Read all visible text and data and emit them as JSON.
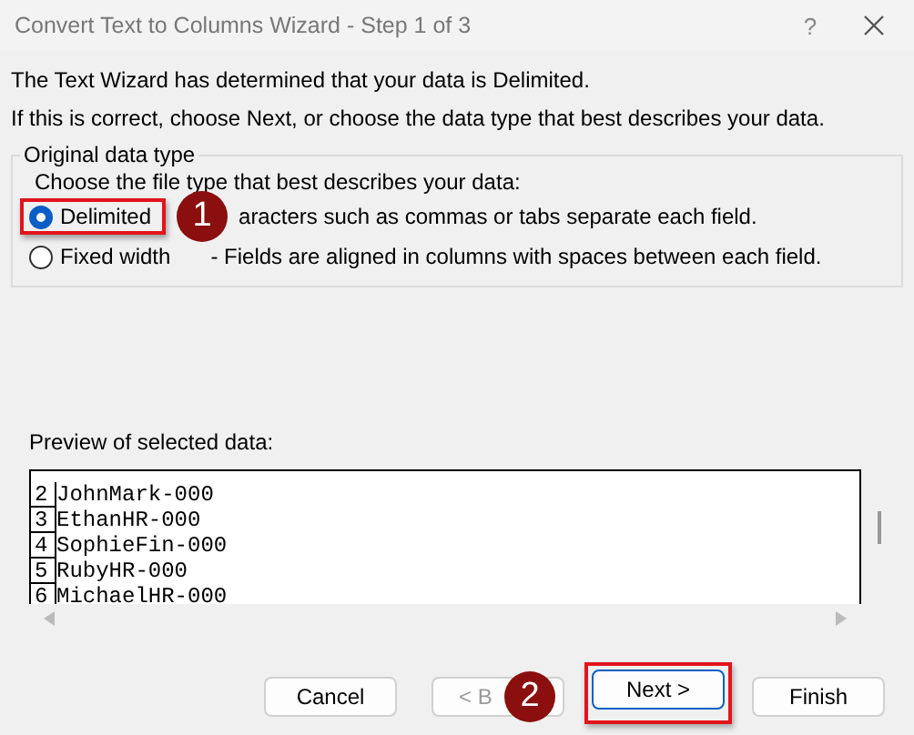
{
  "window": {
    "title": "Convert Text to Columns Wizard - Step 1 of 3",
    "help": "?"
  },
  "intro": [
    "The Text Wizard has determined that your data is Delimited.",
    "If this is correct, choose Next, or choose the data type that best describes your data."
  ],
  "group": {
    "title": "Original data type",
    "prompt": "Choose the file type that best describes your data:",
    "options": [
      {
        "label": "Delimited",
        "description": "aracters such as commas or tabs separate each field.",
        "selected": true,
        "highlighted": true,
        "badge": "1"
      },
      {
        "label": "Fixed width",
        "description": "- Fields are aligned in columns with spaces between each field.",
        "selected": false,
        "highlighted": false
      }
    ]
  },
  "preview": {
    "label": "Preview of selected data:",
    "rows": [
      {
        "number": "2",
        "text": "JohnMark-000"
      },
      {
        "number": "3",
        "text": "EthanHR-000"
      },
      {
        "number": "4",
        "text": "SophieFin-000"
      },
      {
        "number": "5",
        "text": "RubyHR-000"
      },
      {
        "number": "6",
        "text": "MichaelHR-000"
      }
    ]
  },
  "buttons": [
    {
      "label": "Cancel",
      "disabled": false,
      "default": false,
      "highlighted": false
    },
    {
      "label": "< B",
      "disabled": true,
      "default": false,
      "highlighted": false,
      "badge": "2"
    },
    {
      "label": "Next >",
      "disabled": false,
      "default": true,
      "highlighted": true
    },
    {
      "label": "Finish",
      "disabled": false,
      "default": false,
      "highlighted": false
    }
  ]
}
